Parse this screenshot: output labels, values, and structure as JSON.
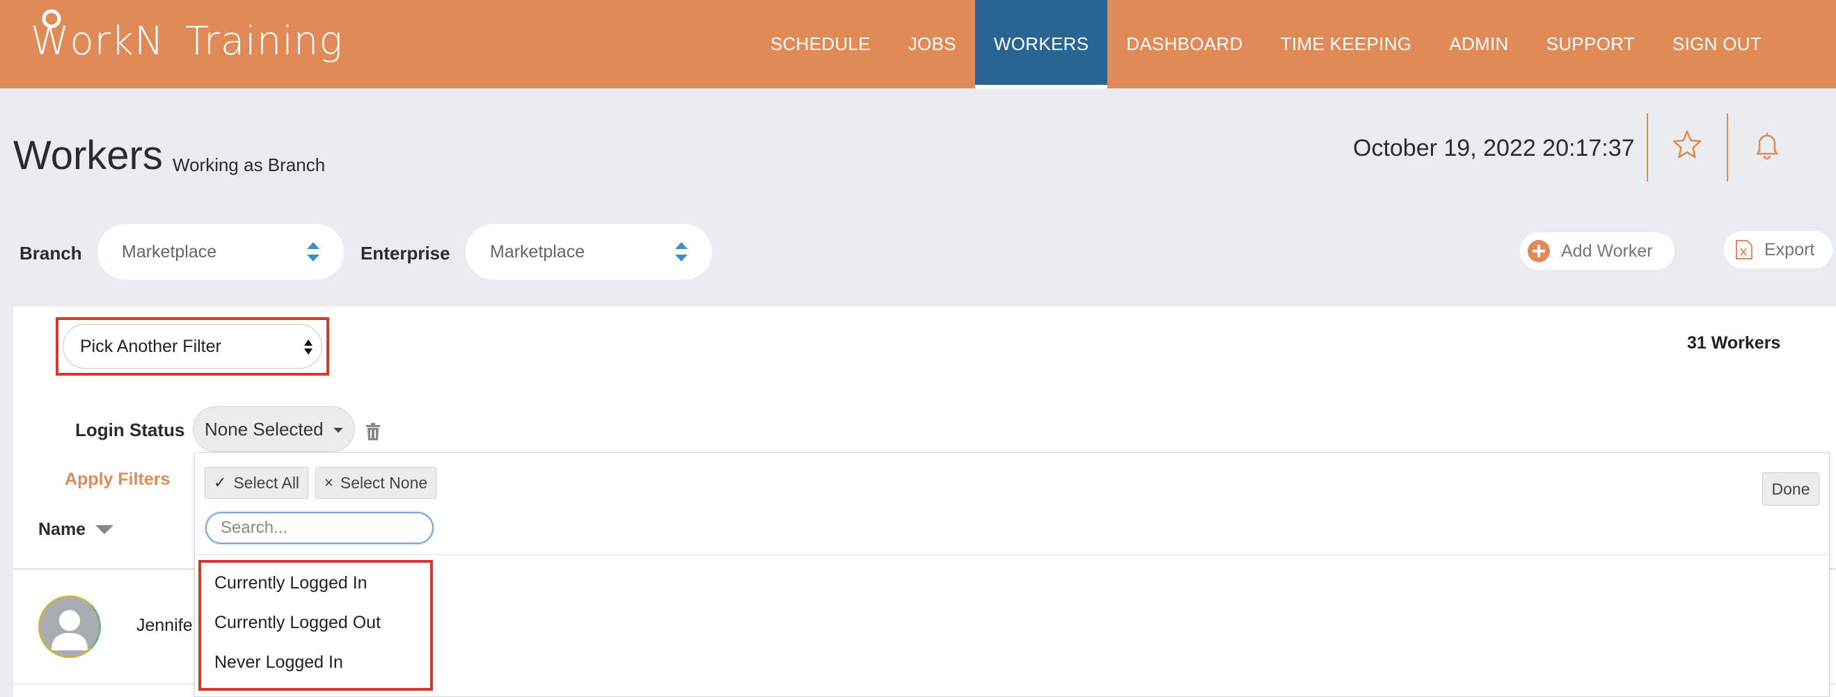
{
  "app": {
    "logo_w": "W",
    "logo_rest": "orkN",
    "logo_suffix": "Training"
  },
  "nav": [
    {
      "label": "SCHEDULE",
      "active": false
    },
    {
      "label": "JOBS",
      "active": false
    },
    {
      "label": "WORKERS",
      "active": true
    },
    {
      "label": "DASHBOARD",
      "active": false
    },
    {
      "label": "TIME KEEPING",
      "active": false
    },
    {
      "label": "ADMIN",
      "active": false
    },
    {
      "label": "SUPPORT",
      "active": false
    },
    {
      "label": "SIGN OUT",
      "active": false
    }
  ],
  "page": {
    "title": "Workers",
    "subtitle": "Working as Branch",
    "datetime": "October 19, 2022 20:17:37"
  },
  "filters": {
    "branch_label": "Branch",
    "branch_value": "Marketplace",
    "enterprise_label": "Enterprise",
    "enterprise_value": "Marketplace",
    "add_worker": "Add Worker",
    "export": "Export",
    "pick_filter": "Pick Another Filter",
    "worker_count": "31 Workers",
    "login_status_label": "Login Status",
    "login_status_value": "None Selected",
    "apply": "Apply Filters"
  },
  "dropdown": {
    "select_all": "Select All",
    "select_none": "Select None",
    "done": "Done",
    "search_placeholder": "Search...",
    "options": [
      "Currently Logged In",
      "Currently Logged Out",
      "Never Logged In"
    ]
  },
  "table": {
    "name_header": "Name",
    "rows": [
      {
        "name": "Jennife"
      }
    ]
  },
  "colors": {
    "brand_orange": "#df8a57",
    "nav_active": "#296592",
    "highlight_red": "#d33a2b"
  }
}
